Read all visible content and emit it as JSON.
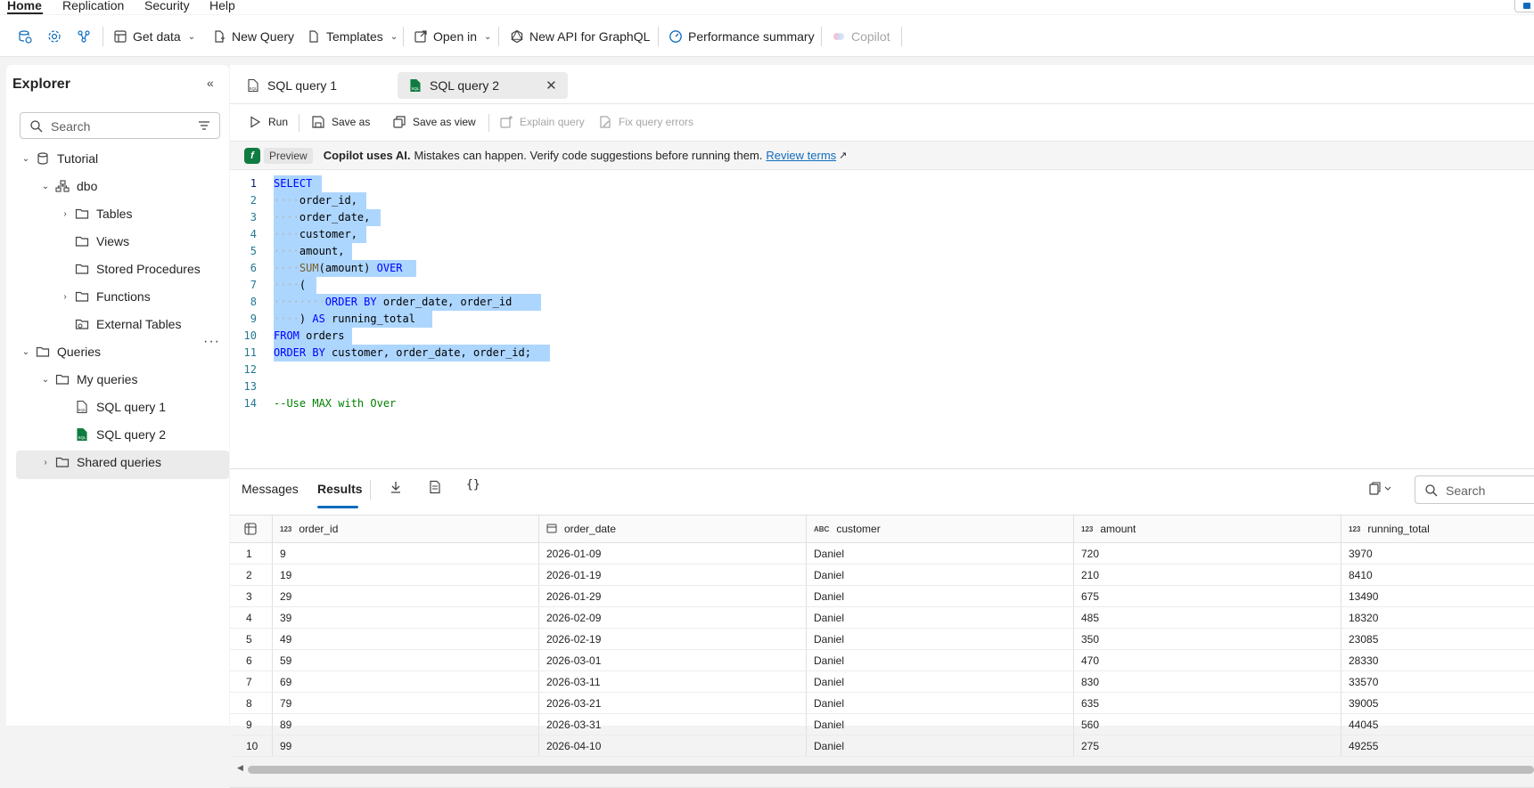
{
  "menu": {
    "items": [
      "Home",
      "Replication",
      "Security",
      "Help"
    ],
    "active": "Home"
  },
  "toolbar": {
    "get_data": "Get data",
    "new_query": "New Query",
    "templates": "Templates",
    "open_in": "Open in",
    "new_api": "New API for GraphQL",
    "performance_summary": "Performance summary",
    "copilot": "Copilot"
  },
  "explorer": {
    "title": "Explorer",
    "search_placeholder": "Search",
    "tree": {
      "tutorial": "Tutorial",
      "dbo": "dbo",
      "tables": "Tables",
      "views": "Views",
      "stored_procedures": "Stored Procedures",
      "functions": "Functions",
      "external_tables": "External Tables",
      "queries": "Queries",
      "my_queries": "My queries",
      "query1": "SQL query 1",
      "query2": "SQL query 2",
      "shared_queries": "Shared queries"
    }
  },
  "tabs": {
    "tab1": "SQL query 1",
    "tab2": "SQL query 2"
  },
  "query_toolbar": {
    "run": "Run",
    "save_as": "Save as",
    "save_as_view": "Save as view",
    "explain_query": "Explain query",
    "fix_query_errors": "Fix query errors"
  },
  "copilot_banner": {
    "preview": "Preview",
    "bold_text": "Copilot uses AI.",
    "text": "Mistakes can happen. Verify code suggestions before running them.",
    "link": "Review terms"
  },
  "editor": {
    "line_numbers": [
      "1",
      "2",
      "3",
      "4",
      "5",
      "6",
      "7",
      "8",
      "9",
      "10",
      "11",
      "12",
      "13",
      "14"
    ]
  },
  "results": {
    "messages_tab": "Messages",
    "results_tab": "Results",
    "search_placeholder": "Search",
    "columns": [
      {
        "type": "123",
        "name": "order_id"
      },
      {
        "type": "date",
        "name": "order_date"
      },
      {
        "type": "ABC",
        "name": "customer"
      },
      {
        "type": "123",
        "name": "amount"
      },
      {
        "type": "123",
        "name": "running_total"
      }
    ],
    "rows": [
      [
        "1",
        "9",
        "2026-01-09",
        "Daniel",
        "720",
        "3970"
      ],
      [
        "2",
        "19",
        "2026-01-19",
        "Daniel",
        "210",
        "8410"
      ],
      [
        "3",
        "29",
        "2026-01-29",
        "Daniel",
        "675",
        "13490"
      ],
      [
        "4",
        "39",
        "2026-02-09",
        "Daniel",
        "485",
        "18320"
      ],
      [
        "5",
        "49",
        "2026-02-19",
        "Daniel",
        "350",
        "23085"
      ],
      [
        "6",
        "59",
        "2026-03-01",
        "Daniel",
        "470",
        "28330"
      ],
      [
        "7",
        "69",
        "2026-03-11",
        "Daniel",
        "830",
        "33570"
      ],
      [
        "8",
        "79",
        "2026-03-21",
        "Daniel",
        "635",
        "39005"
      ],
      [
        "9",
        "89",
        "2026-03-31",
        "Daniel",
        "560",
        "44045"
      ],
      [
        "10",
        "99",
        "2026-04-10",
        "Daniel",
        "275",
        "49255"
      ]
    ]
  },
  "colors": {
    "accent": "#0f6cbd",
    "selection": "#add6ff",
    "keyword": "#0000ff",
    "comment": "#008000",
    "function": "#795e26"
  }
}
